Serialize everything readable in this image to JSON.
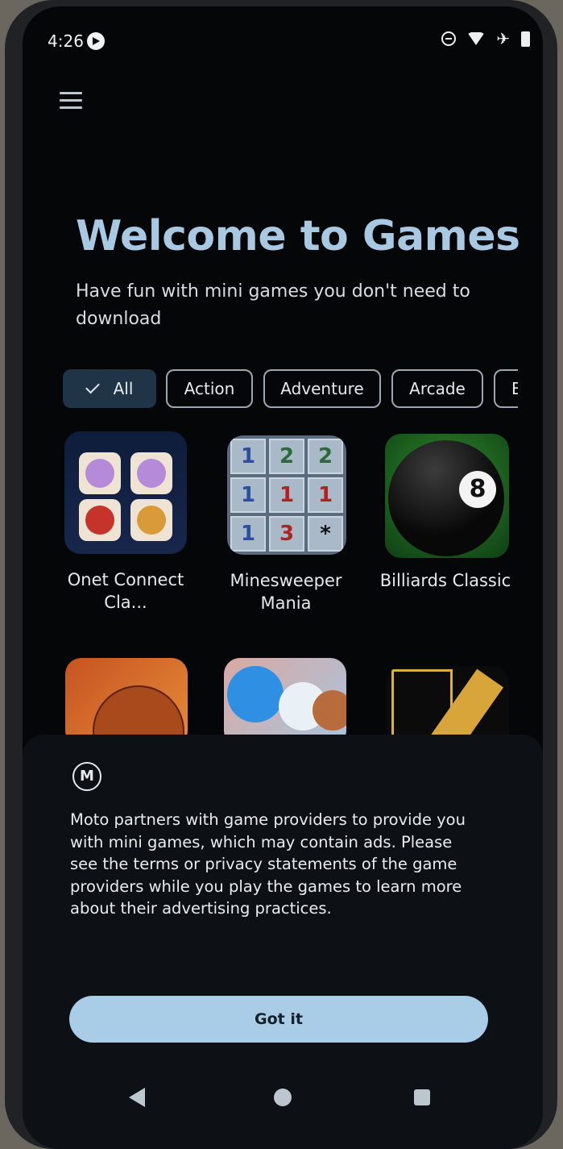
{
  "status_bar": {
    "time": "4:26",
    "icons": [
      "play-notification-icon",
      "do-not-disturb-icon",
      "wifi-icon",
      "airplane-icon",
      "battery-icon"
    ]
  },
  "header": {
    "menu_icon": "menu-icon"
  },
  "welcome": {
    "title": "Welcome to Games",
    "subtitle": "Have fun with mini games you don't need to download"
  },
  "filters": [
    {
      "label": "All",
      "selected": true
    },
    {
      "label": "Action",
      "selected": false
    },
    {
      "label": "Adventure",
      "selected": false
    },
    {
      "label": "Arcade",
      "selected": false
    },
    {
      "label": "B",
      "selected": false
    }
  ],
  "games": [
    {
      "name": "Onet Connect Cla..."
    },
    {
      "name": "Minesweeper Mania"
    },
    {
      "name": "Billiards Classic"
    },
    {
      "name": ""
    },
    {
      "name": ""
    },
    {
      "name": ""
    }
  ],
  "minesweeper_grid": [
    "1",
    "2",
    "2",
    "1",
    "1",
    "1",
    "1",
    "3",
    "*"
  ],
  "billiard_ball_number": "8",
  "notice": {
    "logo_letter": "M",
    "text": "Moto partners with game providers to provide you with mini games, which may contain ads. Please see the terms or privacy statements of the game providers while you play the games to learn more about their advertising practices.",
    "button_label": "Got it"
  },
  "colors": {
    "title": "#a9c9e2",
    "accent_button": "#a9cde6",
    "chip_selected": "#1f3446",
    "background": "#050608"
  }
}
